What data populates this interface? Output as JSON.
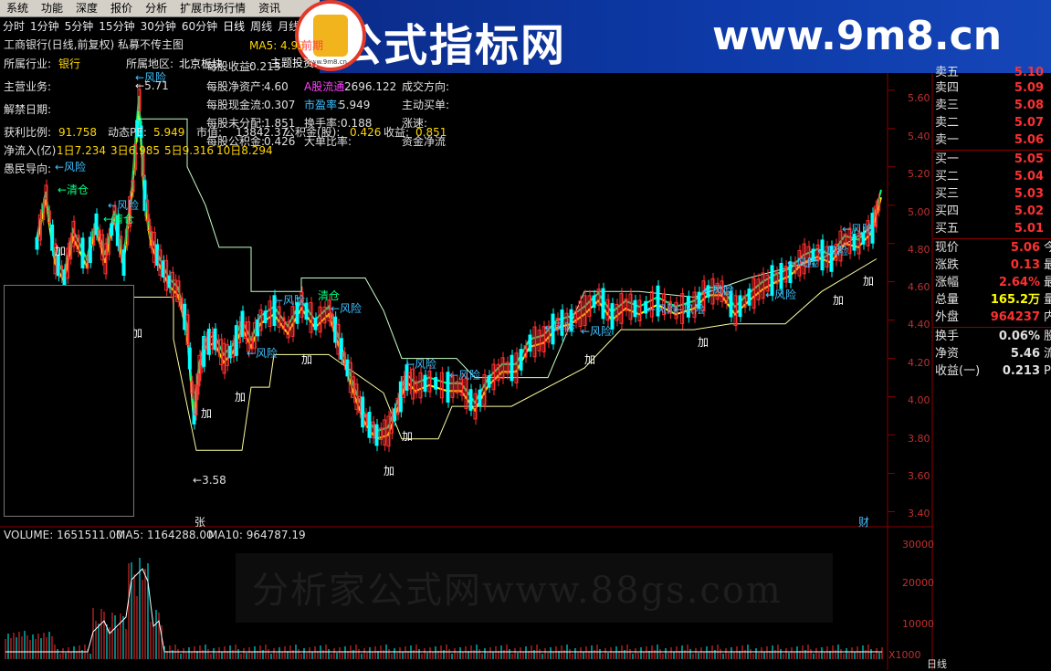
{
  "menu": [
    "系统",
    "功能",
    "深度",
    "报价",
    "分析",
    "扩展市场行情",
    "资讯"
  ],
  "period_tabs": [
    "分时",
    "1分钟",
    "5分钟",
    "15分钟",
    "30分钟",
    "60分钟",
    "日线",
    "周线",
    "月线"
  ],
  "banner": {
    "title": "公式指标网",
    "url": "www.9m8.cn",
    "logo_caption": "www.9m8.cn"
  },
  "header": {
    "stock_title": "工商银行(日线,前复权) 私募不传主图",
    "ma5": "MA5: 4.93",
    "ma5_cut": "前期",
    "industry_label": "所属行业:",
    "industry": "银行",
    "region_label": "所属地区:",
    "region": "北京板块",
    "theme_label": "主题投资:",
    "business_label": "主营业务:",
    "unlock_label": "解禁日期:",
    "profit_ratio_label": "获利比例:",
    "profit_ratio": "91.758",
    "dynamic_pe_label": "动态PE:",
    "dynamic_pe": "5.949",
    "market_cap_label": "市值:",
    "net_inflow_label": "净流入(亿)",
    "net_inflow_1d": "1日7.234",
    "net_inflow_3d": "3日6.985",
    "net_inflow_5d": "5日9.316",
    "net_inflow_10d": "10日8.294",
    "fool_guide_label": "愚民导向:",
    "eps_label": "每股收益:",
    "eps": "0.213",
    "nav_label": "每股净资产:",
    "nav": "4.60",
    "cashflow_label": "每股现金流:",
    "cashflow": "0.307",
    "undist_label": "每股未分配:",
    "undist": "1.851",
    "reserve_label": "每股公积金:",
    "reserve": "0.426",
    "float_label": "A股流通",
    "float": "2696.122",
    "pe_label": "市盈率:",
    "pe": "5.949",
    "turnover_label": "换手率:",
    "turnover": "0.188",
    "big_ratio_label": "大单比率:",
    "mkt_cap_value": "13842.37",
    "reserve_fund_label": "公积金(股):",
    "reserve_fund": "0.426",
    "trade_dir_label": "成交方向:",
    "active_buy_label": "主动买单:",
    "speed_label": "涨速:",
    "income_label": "收益:",
    "income": "0.851",
    "fund_flow_label": "资金净流"
  },
  "chart_data": {
    "type": "candlestick",
    "title": "工商银行(日线,前复权)",
    "y_ticks": [
      "5.60",
      "5.40",
      "5.20",
      "5.00",
      "4.80",
      "4.60",
      "4.40",
      "4.20",
      "4.00",
      "3.80",
      "3.60",
      "3.40"
    ],
    "ylim": [
      3.35,
      5.68
    ],
    "high_label": "5.71",
    "low_label": "3.58",
    "annotations": [
      "←风险",
      "←清仓",
      "←清仓",
      "←风险",
      "加",
      "←风险",
      "←风险",
      "清仓",
      "←风险",
      "加",
      "加",
      "加",
      "←风险",
      "←风险",
      "加",
      "加",
      "←风险",
      "←风险",
      "←风险",
      "←风险",
      "←风险",
      "加",
      "←风险",
      "←风险",
      "←风险",
      "←风险",
      "加",
      "←风险",
      "加"
    ],
    "date_marks": [
      "张",
      "财"
    ],
    "volume": {
      "label": "VOLUME: 1651511.00",
      "ma5": "MA5: 1164288.00",
      "ma10": "MA10: 964787.19",
      "y_ticks": [
        "30000",
        "20000",
        "10000"
      ],
      "unit": "X1000"
    },
    "cut_bottom_label": "日线"
  },
  "quote": {
    "asks": [
      {
        "label": "卖五",
        "price": "5.10"
      },
      {
        "label": "卖四",
        "price": "5.09"
      },
      {
        "label": "卖三",
        "price": "5.08"
      },
      {
        "label": "卖二",
        "price": "5.07"
      },
      {
        "label": "卖一",
        "price": "5.06"
      }
    ],
    "bids": [
      {
        "label": "买一",
        "price": "5.05"
      },
      {
        "label": "买二",
        "price": "5.04"
      },
      {
        "label": "买三",
        "price": "5.03"
      },
      {
        "label": "买四",
        "price": "5.02"
      },
      {
        "label": "买五",
        "price": "5.01"
      }
    ],
    "stats": [
      {
        "label": "现价",
        "value": "5.06",
        "cut": "今"
      },
      {
        "label": "涨跌",
        "value": "0.13",
        "cut": "最"
      },
      {
        "label": "涨幅",
        "value": "2.64%",
        "cut": "最"
      },
      {
        "label": "总量",
        "value": "165.2万",
        "cut": "量"
      },
      {
        "label": "外盘",
        "value": "964237",
        "cut": "内"
      }
    ],
    "stats2": [
      {
        "label": "换手",
        "value": "0.06%",
        "cut": "股"
      },
      {
        "label": "净资",
        "value": "5.46",
        "cut": "流"
      },
      {
        "label": "收益(一)",
        "value": "0.213",
        "cut": "P"
      }
    ]
  },
  "watermark": "分析家公式网www.88gs.com",
  "colors": {
    "up": "#ff3030",
    "down": "#00ffff",
    "grid": "#8b0000",
    "text": "#c0c0c0",
    "accent": "#ffff00"
  }
}
